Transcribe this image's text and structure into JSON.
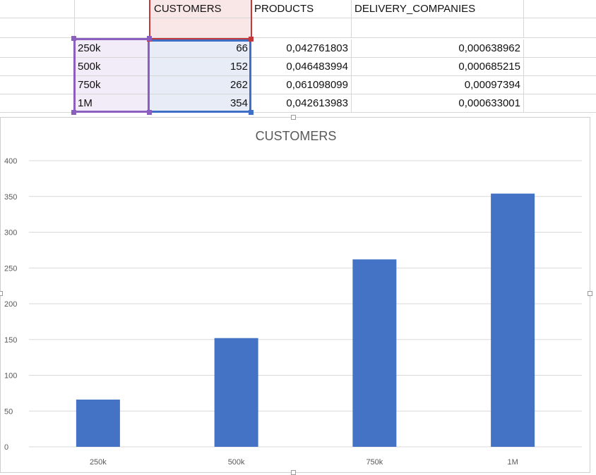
{
  "sheet": {
    "headers": [
      "",
      "CUSTOMERS",
      "PRODUCTS",
      "DELIVERY_COMPANIES",
      ""
    ],
    "rows": [
      {
        "label": "250k",
        "customers": "66",
        "products": "0,042761803",
        "delivery": "0,000638962"
      },
      {
        "label": "500k",
        "customers": "152",
        "products": "0,046483994",
        "delivery": "0,000685215"
      },
      {
        "label": "750k",
        "customers": "262",
        "products": "0,061098099",
        "delivery": "0,00097394"
      },
      {
        "label": "1M",
        "customers": "354",
        "products": "0,042613983",
        "delivery": "0,000633001"
      }
    ]
  },
  "colors": {
    "bar": "#4472c4",
    "grid": "#d9d9d9",
    "axis_text": "#595959",
    "range_red": "#c4373a",
    "range_purple": "#8b5fc0",
    "range_blue": "#3f6ec7"
  },
  "chart_data": {
    "type": "bar",
    "title": "CUSTOMERS",
    "categories": [
      "250k",
      "500k",
      "750k",
      "1M"
    ],
    "values": [
      66,
      152,
      262,
      354
    ],
    "yticks": [
      0,
      50,
      100,
      150,
      200,
      250,
      300,
      350,
      400
    ],
    "ylim": [
      0,
      400
    ],
    "xlabel": "",
    "ylabel": "",
    "grid": true,
    "legend": "none"
  }
}
